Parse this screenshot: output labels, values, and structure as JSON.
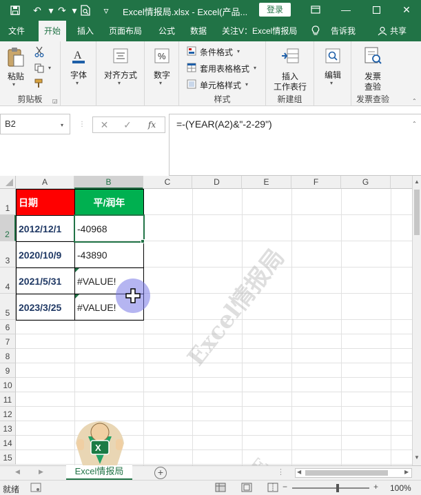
{
  "titlebar": {
    "title": "Excel情报局.xlsx  -  Excel(产品...",
    "login_label": "登录",
    "icons": [
      "save-icon",
      "undo-icon",
      "redo-icon",
      "print-preview-icon",
      "customize-icon",
      "ribbon-display-icon",
      "minimize-icon",
      "maximize-icon",
      "close-icon"
    ]
  },
  "tabs": {
    "items": [
      "文件",
      "开始",
      "插入",
      "页面布局",
      "公式",
      "数据",
      "关注V：Excel情报局"
    ],
    "active": "开始",
    "tell_me": "告诉我",
    "share": "共享"
  },
  "ribbon": {
    "clipboard": {
      "paste": "粘贴",
      "group": "剪贴板"
    },
    "font": {
      "label": "字体"
    },
    "align": {
      "label": "对齐方式"
    },
    "number": {
      "label": "数字"
    },
    "styles": {
      "cond": "条件格式",
      "table": "套用表格格式",
      "cell": "单元格样式",
      "group": "样式"
    },
    "newgroup": {
      "insert_line1": "插入",
      "insert_line2": "工作表行",
      "group": "新建组"
    },
    "edit": {
      "label": "编辑"
    },
    "invoice": {
      "line1": "发票",
      "line2": "查验",
      "group": "发票查验"
    }
  },
  "formula_bar": {
    "name_box": "B2",
    "formula": "=-(YEAR(A2)&\"-2-29\")"
  },
  "grid": {
    "columns": [
      "A",
      "B",
      "C",
      "D",
      "E",
      "F",
      "G"
    ],
    "rows": [
      "1",
      "2",
      "3",
      "4",
      "5",
      "6",
      "7",
      "8",
      "9",
      "10",
      "11",
      "12",
      "13",
      "14",
      "15"
    ],
    "header": {
      "date": "日期",
      "type": "平/润年"
    },
    "data": [
      {
        "date": "2012/12/1",
        "result": "-40968"
      },
      {
        "date": "2020/10/9",
        "result": "-43890"
      },
      {
        "date": "2021/5/31",
        "result": "#VALUE!"
      },
      {
        "date": "2023/3/25",
        "result": "#VALUE!"
      }
    ],
    "watermark": "Excel情报局"
  },
  "sheets": {
    "active": "Excel情报局"
  },
  "status": {
    "text": "就绪",
    "zoom": "100%"
  },
  "colors": {
    "excel_green": "#217346",
    "header_red": "#ff0000",
    "header_green": "#00b050",
    "date_blue": "#1f3864"
  }
}
